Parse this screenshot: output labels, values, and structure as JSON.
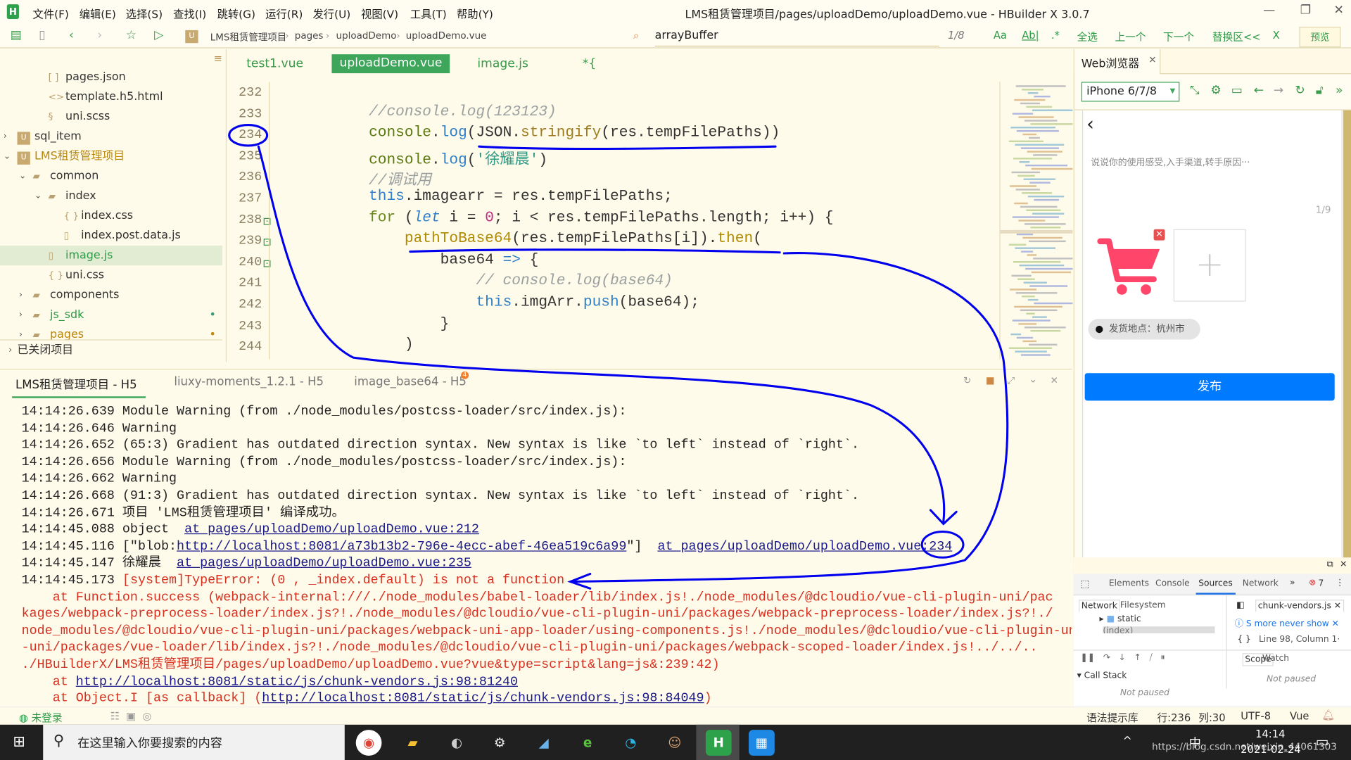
{
  "app": {
    "logo": "H",
    "title": "LMS租赁管理项目/pages/uploadDemo/uploadDemo.vue - HBuilder X 3.0.7",
    "menu": [
      "文件(F)",
      "编辑(E)",
      "选择(S)",
      "查找(I)",
      "跳转(G)",
      "运行(R)",
      "发行(U)",
      "视图(V)",
      "工具(T)",
      "帮助(Y)"
    ]
  },
  "toolbar": {
    "breadcrumb": [
      "LMS租赁管理项目",
      "pages",
      "uploadDemo",
      "uploadDemo.vue"
    ],
    "search_value": "arrayBuffer",
    "match_count": "1/8",
    "case_label": "Aa",
    "word_label": "Ab|",
    "regex_label": ".*",
    "select_all": "全选",
    "prev": "上一个",
    "next": "下一个",
    "replace": "替换区<<",
    "close": "X",
    "preview": "预览"
  },
  "sidebar": {
    "items": [
      {
        "label": "pages.json",
        "icon": "brackets-icon"
      },
      {
        "label": "template.h5.html",
        "icon": "code-icon"
      },
      {
        "label": "uni.scss",
        "icon": "sass-icon"
      },
      {
        "label": "sql_item",
        "icon": "project-icon"
      },
      {
        "label": "LMS租赁管理项目",
        "icon": "project-icon"
      },
      {
        "label": "common",
        "icon": "folder-icon"
      },
      {
        "label": "index",
        "icon": "folder-icon"
      },
      {
        "label": "index.css",
        "icon": "braces-icon"
      },
      {
        "label": "index.post.data.js",
        "icon": "file-icon"
      },
      {
        "label": "image.js",
        "icon": "file-icon"
      },
      {
        "label": "uni.css",
        "icon": "braces-icon"
      },
      {
        "label": "components",
        "icon": "folder-icon"
      },
      {
        "label": "js_sdk",
        "icon": "folder-icon"
      },
      {
        "label": "pages",
        "icon": "folder-icon"
      }
    ],
    "closed_projects": "已关闭项目"
  },
  "editor": {
    "tabs": [
      "test1.vue",
      "uploadDemo.vue",
      "image.js",
      "*{"
    ],
    "active_tab": 1,
    "lines": [
      {
        "num": "232",
        "tokens": []
      },
      {
        "num": "233",
        "tokens": [
          {
            "t": "//console.log(123123)",
            "c": "cm"
          }
        ]
      },
      {
        "num": "234",
        "tokens": [
          {
            "t": "console",
            "c": "obj"
          },
          {
            "t": ".",
            "c": "p"
          },
          {
            "t": "log",
            "c": "fn"
          },
          {
            "t": "(JSON.",
            "c": "p"
          },
          {
            "t": "stringify",
            "c": "meth"
          },
          {
            "t": "(res.tempFilePaths))",
            "c": "p"
          }
        ]
      },
      {
        "num": "235",
        "tokens": [
          {
            "t": "console",
            "c": "obj"
          },
          {
            "t": ".",
            "c": "p"
          },
          {
            "t": "log",
            "c": "fn"
          },
          {
            "t": "(",
            "c": "p"
          },
          {
            "t": "'徐耀晨'",
            "c": "str"
          },
          {
            "t": ")",
            "c": "p"
          }
        ]
      },
      {
        "num": "236",
        "tokens": [
          {
            "t": "//调试用",
            "c": "cm"
          }
        ]
      },
      {
        "num": "237",
        "tokens": [
          {
            "t": "this",
            "c": "this"
          },
          {
            "t": ".imagearr = res.tempFilePaths;",
            "c": "p"
          }
        ]
      },
      {
        "num": "238",
        "tokens": [
          {
            "t": "for",
            "c": "kw"
          },
          {
            "t": " (",
            "c": "p"
          },
          {
            "t": "let",
            "c": "kwi"
          },
          {
            "t": " i = ",
            "c": "p"
          },
          {
            "t": "0",
            "c": "num"
          },
          {
            "t": "; i < res.tempFilePaths.length; i++) {",
            "c": "p"
          }
        ]
      },
      {
        "num": "239",
        "tokens": [
          {
            "t": "    ",
            "c": "p"
          },
          {
            "t": "pathToBase64",
            "c": "call"
          },
          {
            "t": "(res.tempFilePaths[i]).",
            "c": "p"
          },
          {
            "t": "then",
            "c": "call"
          },
          {
            "t": "(",
            "c": "p"
          }
        ]
      },
      {
        "num": "240",
        "tokens": [
          {
            "t": "        base64 ",
            "c": "p"
          },
          {
            "t": "=>",
            "c": "fn"
          },
          {
            "t": " {",
            "c": "p"
          }
        ]
      },
      {
        "num": "241",
        "tokens": [
          {
            "t": "            // console.log(base64)",
            "c": "cm"
          }
        ]
      },
      {
        "num": "242",
        "tokens": [
          {
            "t": "            ",
            "c": "p"
          },
          {
            "t": "this",
            "c": "this"
          },
          {
            "t": ".imgArr.",
            "c": "p"
          },
          {
            "t": "push",
            "c": "fn"
          },
          {
            "t": "(base64);",
            "c": "p"
          }
        ]
      },
      {
        "num": "243",
        "tokens": [
          {
            "t": "        }",
            "c": "p"
          }
        ]
      },
      {
        "num": "244",
        "tokens": [
          {
            "t": "    )",
            "c": "p"
          }
        ]
      }
    ]
  },
  "console": {
    "tabs": [
      "LMS租赁管理项目 - H5",
      "liuxy-moments_1.2.1 - H5",
      "image_base64 - H5"
    ],
    "badge": "4",
    "lines": [
      [
        {
          "t": "14:14:26.639 Module Warning (from ./node_modules/postcss-loader/src/index.js):",
          "k": "txt"
        }
      ],
      [
        {
          "t": "14:14:26.646 Warning",
          "k": "txt"
        }
      ],
      [
        {
          "t": "14:14:26.652 (65:3) Gradient has outdated direction syntax. New syntax is like `to left` instead of `right`.",
          "k": "txt"
        }
      ],
      [
        {
          "t": "14:14:26.656 Module Warning (from ./node_modules/postcss-loader/src/index.js):",
          "k": "txt"
        }
      ],
      [
        {
          "t": "14:14:26.662 Warning",
          "k": "txt"
        }
      ],
      [
        {
          "t": "14:14:26.668 (91:3) Gradient has outdated direction syntax. New syntax is like `to left` instead of `right`.",
          "k": "txt"
        }
      ],
      [
        {
          "t": "14:14:26.671 项目 'LMS租赁管理项目' 编译成功。",
          "k": "txt"
        }
      ],
      [
        {
          "t": "14:14:45.088 object  ",
          "k": "txt"
        },
        {
          "t": "at pages/uploadDemo/uploadDemo.vue:212",
          "k": "link"
        }
      ],
      [
        {
          "t": "14:14:45.116 [\"blob:",
          "k": "txt"
        },
        {
          "t": "http://localhost:8081/a73b13b2-796e-4ecc-abef-46ea519c6a99",
          "k": "link"
        },
        {
          "t": "\"]  ",
          "k": "txt"
        },
        {
          "t": "at pages/uploadDemo/uploadDemo.vue:234",
          "k": "link"
        }
      ],
      [
        {
          "t": "14:14:45.147 徐耀晨  ",
          "k": "txt"
        },
        {
          "t": "at pages/uploadDemo/uploadDemo.vue:235",
          "k": "link"
        }
      ],
      [
        {
          "t": "14:14:45.173 ",
          "k": "txt"
        },
        {
          "t": "[system]TypeError: (0 , _index.default) is not a function",
          "k": "err"
        }
      ],
      [
        {
          "t": "    at Function.success (webpack-internal:///./node_modules/babel-loader/lib/index.js!./node_modules/@dcloudio/vue-cli-plugin-uni/pac",
          "k": "err"
        }
      ],
      [
        {
          "t": "kages/webpack-preprocess-loader/index.js?!./node_modules/@dcloudio/vue-cli-plugin-uni/packages/webpack-preprocess-loader/index.js?!./",
          "k": "err"
        }
      ],
      [
        {
          "t": "node_modules/@dcloudio/vue-cli-plugin-uni/packages/webpack-uni-app-loader/using-components.js!./node_modules/@dcloudio/vue-cli-plugin-uni",
          "k": "err"
        }
      ],
      [
        {
          "t": "-uni/packages/vue-loader/lib/index.js?!./node_modules/@dcloudio/vue-cli-plugin-uni/packages/webpack-scoped-loader/index.js!../../..",
          "k": "err"
        }
      ],
      [
        {
          "t": "./HBuilderX/LMS租赁管理项目/pages/uploadDemo/uploadDemo.vue?vue&type=script&lang=js&:239:42)",
          "k": "err"
        }
      ],
      [
        {
          "t": "    at ",
          "k": "err"
        },
        {
          "t": "http://localhost:8081/static/js/chunk-vendors.js:98:81240",
          "k": "errlink"
        }
      ],
      [
        {
          "t": "    at Object.I [as callback] (",
          "k": "err"
        },
        {
          "t": "http://localhost:8081/static/js/chunk-vendors.js:98:84049",
          "k": "errlink"
        },
        {
          "t": ")",
          "k": "err"
        }
      ]
    ]
  },
  "browser": {
    "tab": "Web浏览器",
    "device": "iPhone 6/7/8",
    "placeholder": "说说你的使用感受,入手渠道,转手原因···",
    "image_count": "1/9",
    "location": "发货地点：杭州市",
    "publish": "发布",
    "cart_color": "#ff4569",
    "button_color": "#007aff"
  },
  "devtools": {
    "tabs": [
      "Elements",
      "Console",
      "Sources",
      "Network"
    ],
    "active": "Sources",
    "error_count": "7",
    "nav_tabs": [
      "Network",
      "Filesystem"
    ],
    "tree": [
      "static",
      "(index)"
    ],
    "file_tab": "chunk-vendors.js",
    "info": "S more  never show",
    "position": "Line 98, Column 1·",
    "scope": "Scope",
    "watch": "Watch",
    "call_stack": "Call Stack",
    "not_paused": "Not paused"
  },
  "status": {
    "login": "未登录",
    "hint": "语法提示库",
    "row": "行:236",
    "col": "列:30",
    "encoding": "UTF-8",
    "lang": "Vue"
  },
  "taskbar": {
    "search": "在这里输入你要搜索的内容",
    "time": "14:14",
    "date": "2021-02-24",
    "ime": "中",
    "watermark": "https://blog.csdn.net/weixin_44061303"
  }
}
